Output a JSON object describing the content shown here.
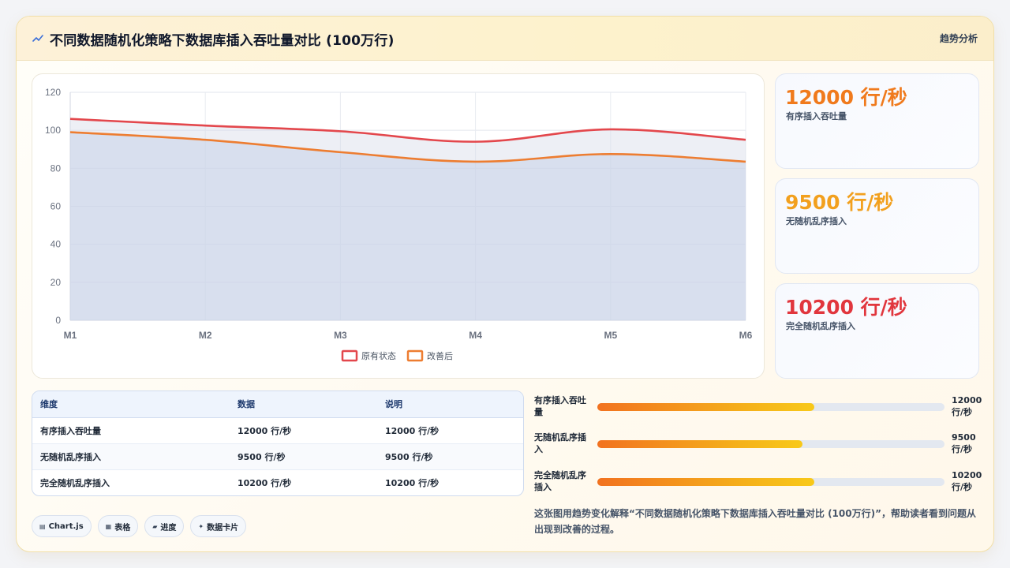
{
  "header": {
    "title_icon": "trend-line-icon",
    "title": "不同数据随机化策略下数据库插入吞吐量对比 (100万行)",
    "action_label": "趋势分析"
  },
  "chart_data": {
    "type": "area",
    "categories": [
      "M1",
      "M2",
      "M3",
      "M4",
      "M5",
      "M6"
    ],
    "series": [
      {
        "name": "原有状态",
        "values": [
          106,
          102.5,
          99.5,
          94,
          100.5,
          95
        ],
        "color": "#e3474c"
      },
      {
        "name": "改善后",
        "values": [
          99,
          95,
          88.5,
          83.5,
          87.5,
          83.5
        ],
        "color": "#ed7d31"
      }
    ],
    "yticks": [
      0,
      20,
      40,
      60,
      80,
      100,
      120
    ],
    "ylim": [
      0,
      120
    ],
    "grid": true,
    "legend_position": "bottom-center"
  },
  "kpis": [
    {
      "value": "12000 行/秒",
      "label": "有序插入吞吐量",
      "color": "#f07a1c"
    },
    {
      "value": "9500 行/秒",
      "label": "无随机乱序插入",
      "color": "#f2a01e"
    },
    {
      "value": "10200 行/秒",
      "label": "完全随机乱序插入",
      "color": "#e1363d"
    }
  ],
  "table": {
    "headers": [
      "维度",
      "数据",
      "说明"
    ],
    "rows": [
      [
        "有序插入吞吐量",
        "12000 行/秒",
        "12000 行/秒"
      ],
      [
        "无随机乱序插入",
        "9500 行/秒",
        "9500 行/秒"
      ],
      [
        "完全随机乱序插入",
        "10200 行/秒",
        "10200 行/秒"
      ]
    ]
  },
  "progress": [
    {
      "label": "有序插入吞吐量",
      "value_text": "12000 行/秒",
      "fraction": 0.625
    },
    {
      "label": "无随机乱序插入",
      "value_text": "9500 行/秒",
      "fraction": 0.592
    },
    {
      "label": "完全随机乱序插入",
      "value_text": "10200 行/秒",
      "fraction": 0.625
    }
  ],
  "chips": [
    {
      "icon": "chart-icon",
      "glyph": "▤",
      "label": "Chart.js"
    },
    {
      "icon": "table-icon",
      "glyph": "▦",
      "label": "表格"
    },
    {
      "icon": "progress-icon",
      "glyph": "▰",
      "label": "进度"
    },
    {
      "icon": "sparkle-icon",
      "glyph": "✦",
      "label": "数据卡片"
    }
  ],
  "description": "这张图用趋势变化解释“不同数据随机化策略下数据库插入吞吐量对比 (100万行)”，帮助读者看到问题从出现到改善的过程。"
}
